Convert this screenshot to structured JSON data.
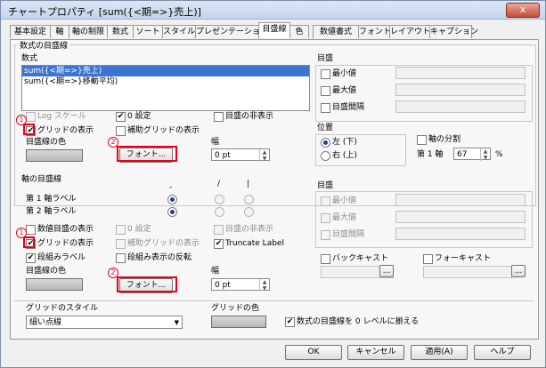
{
  "window": {
    "title": "チャートプロパティ [sum({<期=>}売上)]",
    "close_label": "x"
  },
  "tabs": [
    "基本設定",
    "軸",
    "軸の制限",
    "数式",
    "ソート",
    "スタイル",
    "プレゼンテーション",
    "目盛線",
    "色",
    "数値書式",
    "フォント",
    "レイアウト",
    "キャプション"
  ],
  "active_tab": "目盛線",
  "expr_grid": {
    "group_title": "数式の目盛線",
    "list_label": "数式",
    "items": [
      "sum({<期=>}売上)",
      "sum({<期=>}移動平均)"
    ],
    "log_scale": "Log スケール",
    "zero_setting": "0 設定",
    "hide_scale": "目盛の非表示",
    "show_grid": "グリッドの表示",
    "aux_grid": "補助グリッドの表示",
    "grid_color": "目盛線の色",
    "font_button": "フォント...",
    "width_label": "幅",
    "width_value": "0 pt",
    "scale_title": "目盛",
    "min": "最小値",
    "max": "最大値",
    "interval": "目盛間隔",
    "position_title": "位置",
    "left": "左 (下)",
    "right": "右 (上)",
    "split_axis": "軸の分割",
    "first_axis_label": "第 1 軸",
    "split_value": "67",
    "split_unit": "%"
  },
  "axis_grid": {
    "group_title": "軸の目盛線",
    "col_dash": "-",
    "col_slash": "/",
    "col_pipe": "|",
    "dim1": "第 1 軸ラベル",
    "dim2": "第 2 軸ラベル",
    "show_numeric": "数値目盛の表示",
    "zero_setting": "0 設定",
    "hide_scale": "目盛の非表示",
    "show_grid": "グリッドの表示",
    "aux_grid": "補助グリッドの表示",
    "truncate": "Truncate Label",
    "stagger": "段組みラベル",
    "stagger_reverse": "段組み表示の反転",
    "grid_color": "目盛線の色",
    "font_button": "フォント...",
    "width_label": "幅",
    "width_value": "0 pt",
    "scale_title": "目盛",
    "min": "最小値",
    "max": "最大値",
    "interval": "目盛間隔",
    "backcast": "バックキャスト",
    "forecast": "フォーキャスト",
    "browse": "..."
  },
  "footer": {
    "grid_style_label": "グリッドのスタイル",
    "grid_style_value": "細い点線",
    "grid_color_label": "グリッドの色",
    "align_zero": "数式の目盛線を 0 レベルに揃える",
    "ok": "OK",
    "cancel": "キャンセル",
    "apply": "適用(A)",
    "help": "ヘルプ"
  },
  "markers": {
    "one": "1",
    "two": "2"
  },
  "checkmark": "✔",
  "colors": {
    "highlight": "#e8001c",
    "selection": "#3d74d2"
  }
}
